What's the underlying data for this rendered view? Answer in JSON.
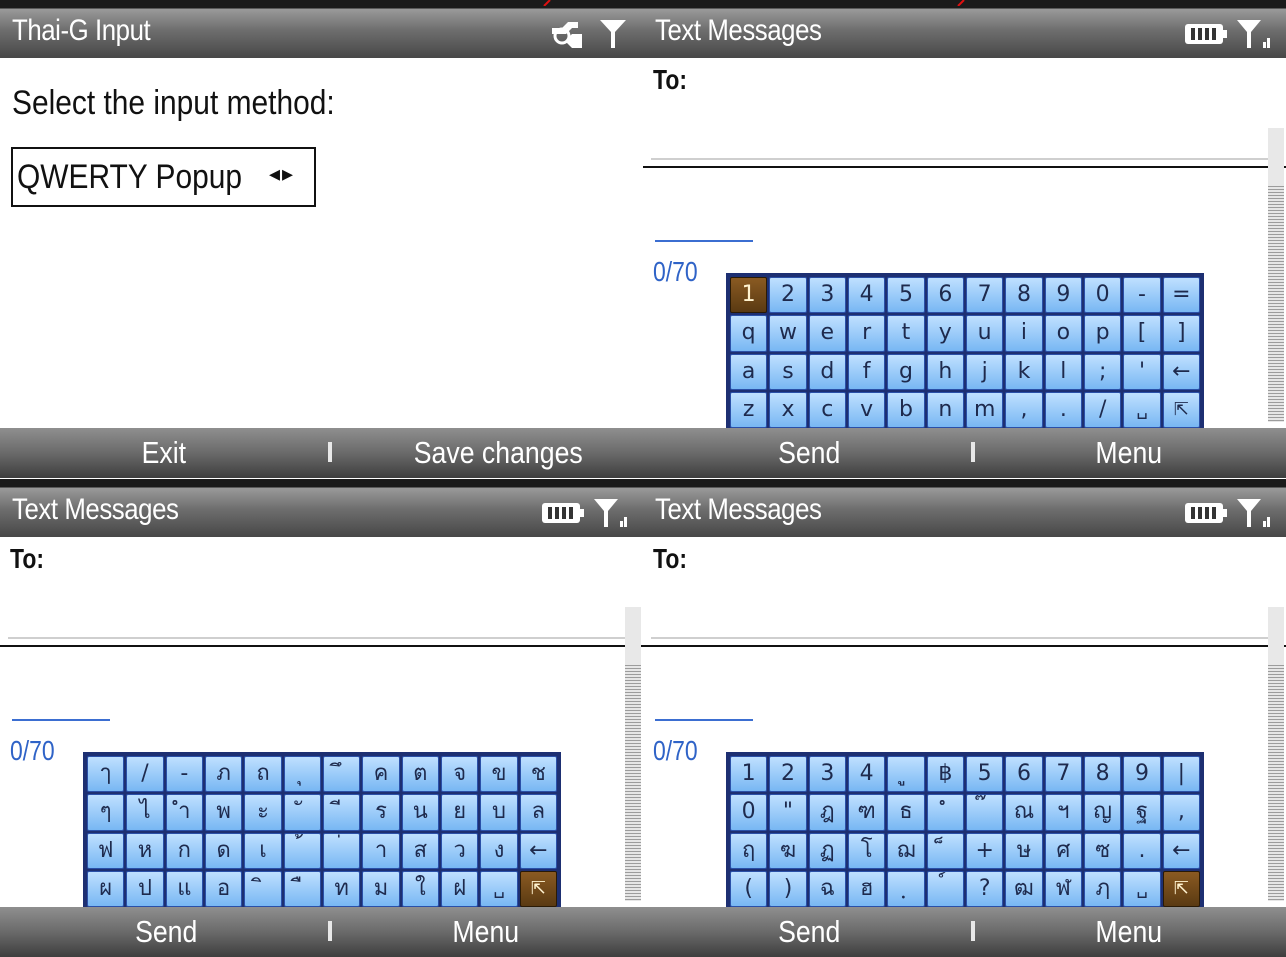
{
  "panels": {
    "settings": {
      "title": "Thai-G Input",
      "prompt": "Select the input method:",
      "method_value": "QWERTY Popup",
      "method_arrows": "◂▸",
      "softkey_left": "Exit",
      "softkey_right": "Save changes"
    },
    "english_kb": {
      "title": "Text Messages",
      "to_label": "To:",
      "counter": "0/70",
      "softkey_left": "Send",
      "softkey_right": "Menu",
      "keys": [
        "1",
        "2",
        "3",
        "4",
        "5",
        "6",
        "7",
        "8",
        "9",
        "0",
        "-",
        "=",
        "q",
        "w",
        "e",
        "r",
        "t",
        "y",
        "u",
        "i",
        "o",
        "p",
        "[",
        "]",
        "a",
        "s",
        "d",
        "f",
        "g",
        "h",
        "j",
        "k",
        "l",
        ";",
        "'",
        "←",
        "z",
        "x",
        "c",
        "v",
        "b",
        "n",
        "m",
        ",",
        ".",
        "/",
        "␣",
        "⇱"
      ]
    },
    "thai_kb": {
      "title": "Text Messages",
      "to_label": "To:",
      "counter": "0/70",
      "softkey_left": "Send",
      "softkey_right": "Menu",
      "keys": [
        "ๅ",
        "/",
        "-",
        "ภ",
        "ถ",
        "ุ",
        "ึ",
        "ค",
        "ต",
        "จ",
        "ข",
        "ช",
        "ๆ",
        "ไ",
        "ำ",
        "พ",
        "ะ",
        "ั",
        "ี",
        "ร",
        "น",
        "ย",
        "บ",
        "ล",
        "ฟ",
        "ห",
        "ก",
        "ด",
        "เ",
        "้",
        "่",
        "า",
        "ส",
        "ว",
        "ง",
        "←",
        "ผ",
        "ป",
        "แ",
        "อ",
        "ิ",
        "ื",
        "ท",
        "ม",
        "ใ",
        "ฝ",
        "␣",
        "⇱"
      ]
    },
    "thai_shift_kb": {
      "title": "Text Messages",
      "to_label": "To:",
      "counter": "0/70",
      "softkey_left": "Send",
      "softkey_right": "Menu",
      "keys": [
        "1",
        "2",
        "3",
        "4",
        "ู",
        "฿",
        "5",
        "6",
        "7",
        "8",
        "9",
        "|",
        "0",
        "\"",
        "ฎ",
        "ฑ",
        "ธ",
        "ํ",
        "๊",
        "ณ",
        "ฯ",
        "ญ",
        "ฐ",
        ",",
        "ฤ",
        "ฆ",
        "ฏ",
        "โ",
        "ฌ",
        "็",
        "+",
        "ษ",
        "ศ",
        "ซ",
        ".",
        "←",
        "(",
        ")",
        "ฉ",
        "ฮ",
        "ฺ",
        "์",
        "?",
        "ฒ",
        "ฬ",
        "ฦ",
        "␣",
        "⇱"
      ]
    }
  },
  "colors": {
    "key_blue": "#78b7f3",
    "key_selected": "#6e4a1a",
    "counter_blue": "#2f63c7",
    "keyboard_border": "#1d2f72"
  },
  "icons": {
    "settings_status": [
      "connection-icon",
      "signal-icon"
    ],
    "messages_status": [
      "battery-icon",
      "signal-icon"
    ]
  }
}
